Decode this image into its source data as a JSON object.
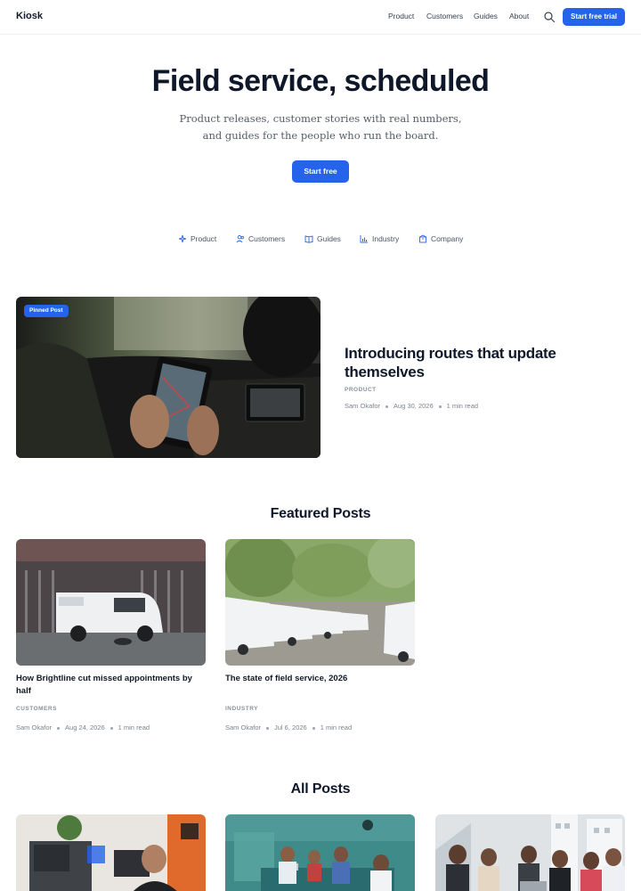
{
  "header": {
    "brand": "Kiosk",
    "nav": [
      "Product",
      "Customers",
      "Guides",
      "About"
    ],
    "search_icon": "search-icon",
    "cta_label": "Start free trial"
  },
  "hero": {
    "title": "Field service, scheduled",
    "subtitle": "Product releases, customer stories with real numbers, and guides for the people who run the board.",
    "cta_label": "Start free"
  },
  "categories": [
    {
      "label": "Product",
      "icon": "sparkles-icon"
    },
    {
      "label": "Customers",
      "icon": "users-icon"
    },
    {
      "label": "Guides",
      "icon": "book-icon"
    },
    {
      "label": "Industry",
      "icon": "bar-chart-icon"
    },
    {
      "label": "Company",
      "icon": "building-icon"
    }
  ],
  "pinned": {
    "badge": "Pinned Post",
    "title": "Introducing routes that update themselves",
    "category": "PRODUCT",
    "author": "Sam Okafor",
    "date": "Aug 30, 2026",
    "read_time": "1 min read"
  },
  "featured": {
    "heading": "Featured Posts",
    "posts": [
      {
        "title": "How Brightline cut missed appointments by half",
        "category": "CUSTOMERS",
        "author": "Sam Okafor",
        "date": "Aug 24, 2026",
        "read_time": "1 min read"
      },
      {
        "title": "The state of field service, 2026",
        "category": "INDUSTRY",
        "author": "Sam Okafor",
        "date": "Jul 6, 2026",
        "read_time": "1 min read"
      }
    ]
  },
  "all_posts": {
    "heading": "All Posts"
  },
  "colors": {
    "accent": "#2563eb",
    "text": "#0f172a",
    "muted": "#7b828c"
  }
}
